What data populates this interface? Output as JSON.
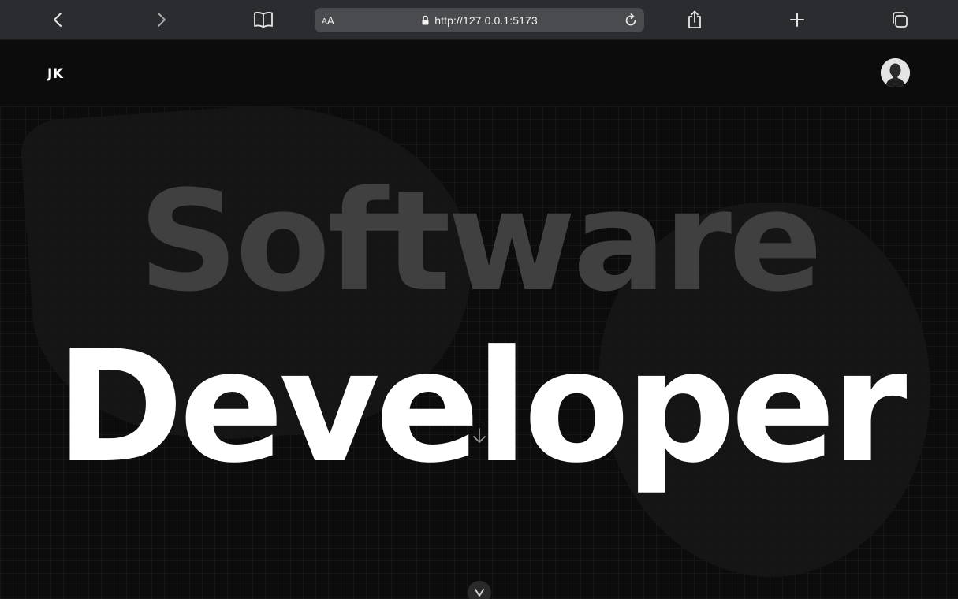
{
  "browser": {
    "reader_label_small": "A",
    "reader_label_big": "A",
    "url": "http://127.0.0.1:5173"
  },
  "site": {
    "logo": "JK",
    "avatar_alt": "profile photo"
  },
  "hero": {
    "line1": "Software",
    "line2": "Developer"
  },
  "icons": {
    "back": "chevron-left-icon",
    "forward": "chevron-right-icon",
    "bookmarks": "book-icon",
    "lock": "lock-icon",
    "reload": "reload-icon",
    "share": "share-icon",
    "new_tab": "plus-icon",
    "tabs": "tabs-icon",
    "scroll": "chevron-down-icon"
  },
  "colors": {
    "toolbar_bg": "#2b2c2f",
    "address_bg": "#4a4b4e",
    "page_bg": "#0c0c0c",
    "hero_dim": "#404040",
    "hero_bright": "#ffffff"
  }
}
